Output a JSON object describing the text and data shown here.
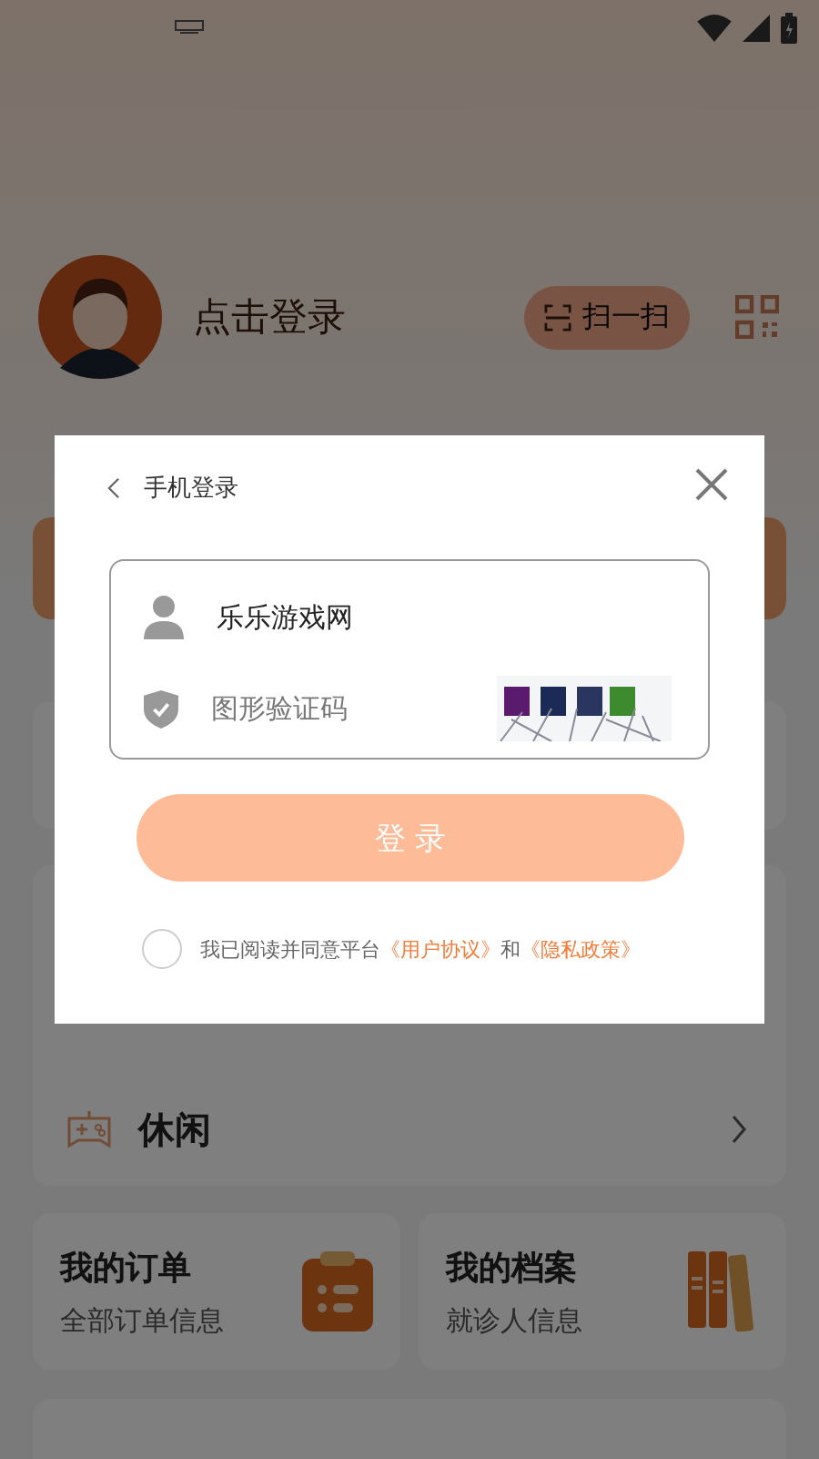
{
  "profile": {
    "login_text": "点击登录",
    "scan_button": "扫一扫"
  },
  "menu_rows": [
    {
      "label": "休闲",
      "kind": "game"
    }
  ],
  "info_cards": [
    {
      "title": "我的订单",
      "subtitle": "全部订单信息",
      "kind": "order"
    },
    {
      "title": "我的档案",
      "subtitle": "就诊人信息",
      "kind": "records"
    }
  ],
  "dialog": {
    "title": "手机登录",
    "account": {
      "value": "乐乐游戏网"
    },
    "captcha": {
      "placeholder": "图形验证码"
    },
    "login_button": "登 录",
    "agreement": {
      "checked": false,
      "text": "我已阅读并同意平台",
      "link_1": "《用户协议》",
      "joiner": "和",
      "link_2": "《隐私政策》"
    }
  }
}
